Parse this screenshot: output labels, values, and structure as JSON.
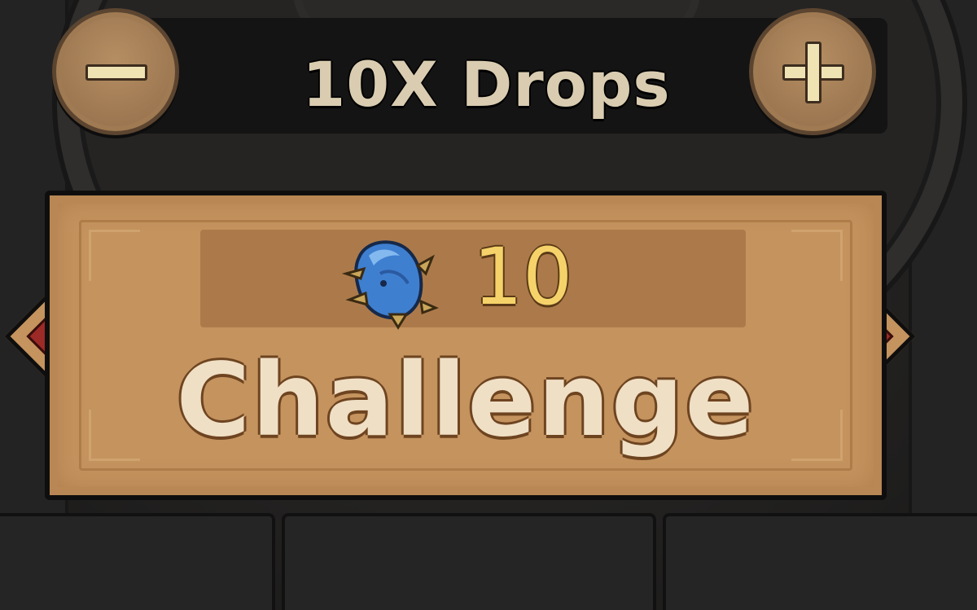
{
  "drops": {
    "label": "10X Drops",
    "minus_icon": "minus-icon",
    "plus_icon": "plus-icon"
  },
  "challenge": {
    "cost_icon": "blue-crystal-stamina-icon",
    "cost_value": "10",
    "label": "Challenge"
  },
  "colors": {
    "panel": "#c4935e",
    "cost_text": "#f5d36a",
    "label_text": "#efdfc5",
    "gem": "#9c2a26"
  }
}
